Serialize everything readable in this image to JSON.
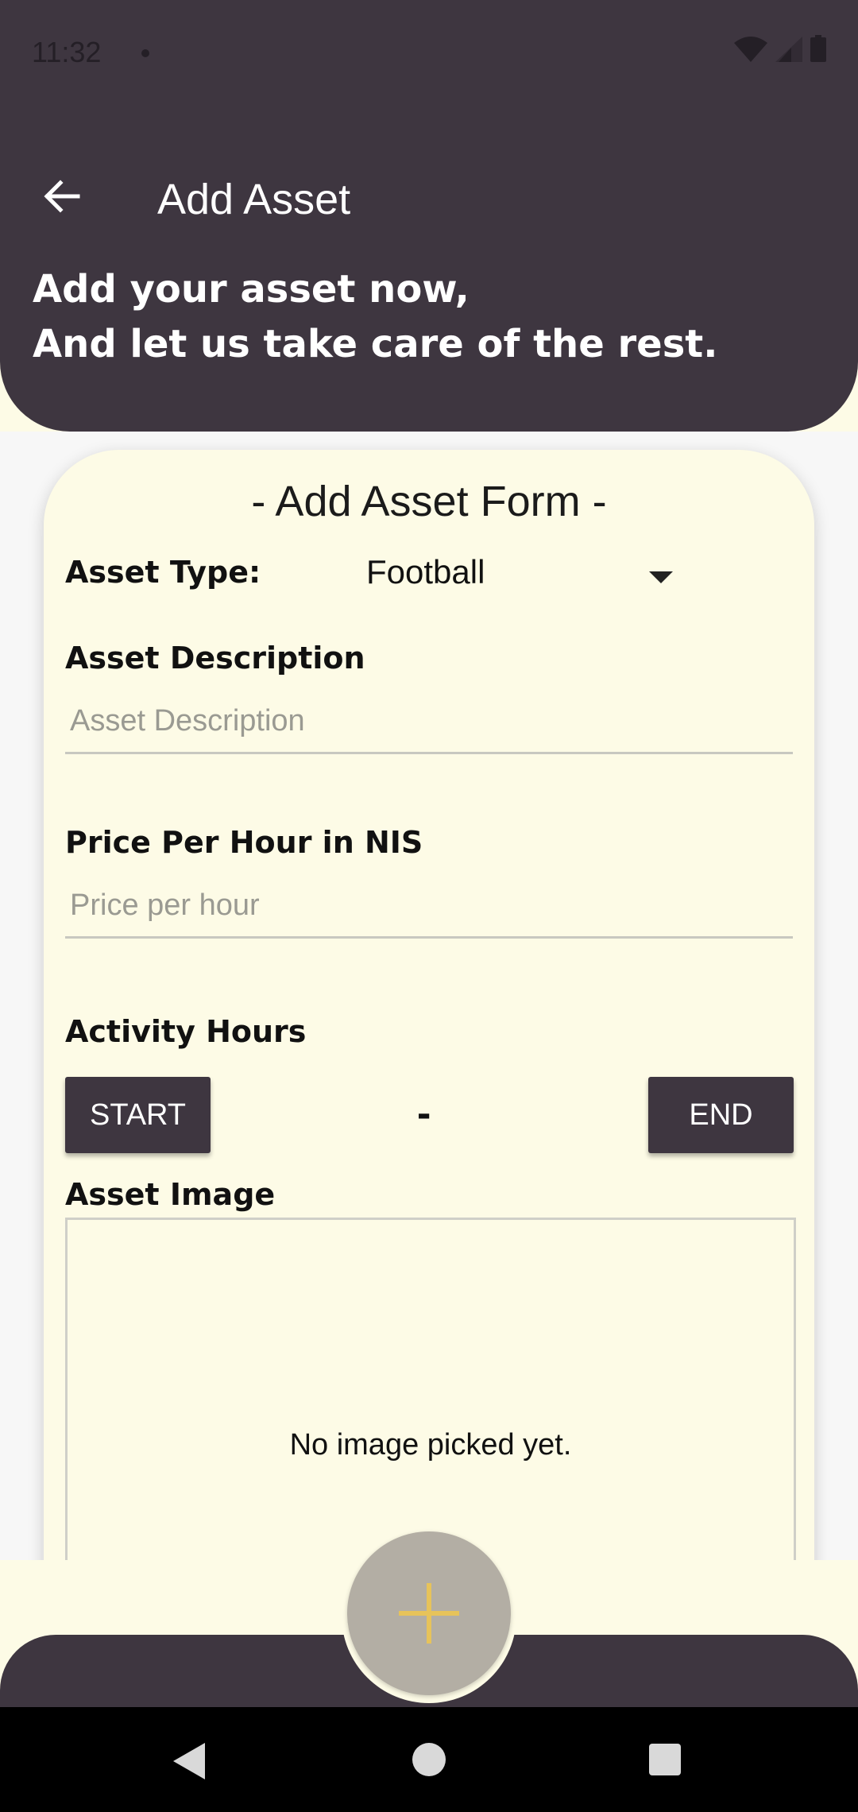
{
  "status_bar": {
    "time": "11:32"
  },
  "header": {
    "title": "Add Asset",
    "tagline_line1": "Add your asset now,",
    "tagline_line2": "And let us take care of the rest."
  },
  "form": {
    "title": "- Add Asset Form -",
    "asset_type_label": "Asset Type:",
    "asset_type_value": "Football",
    "description_label": "Asset Description",
    "description_placeholder": "Asset Description",
    "price_label": "Price Per Hour in NIS",
    "price_placeholder": "Price per hour",
    "hours_label": "Activity Hours",
    "start_button": "START",
    "separator": "-",
    "end_button": "END",
    "image_label": "Asset Image",
    "no_image_text": "No image picked yet."
  },
  "colors": {
    "header_bg": "#3e3640",
    "card_bg": "#fdfbe6",
    "fab_bg": "#b3aea4",
    "fab_icon": "#e7c35a"
  }
}
